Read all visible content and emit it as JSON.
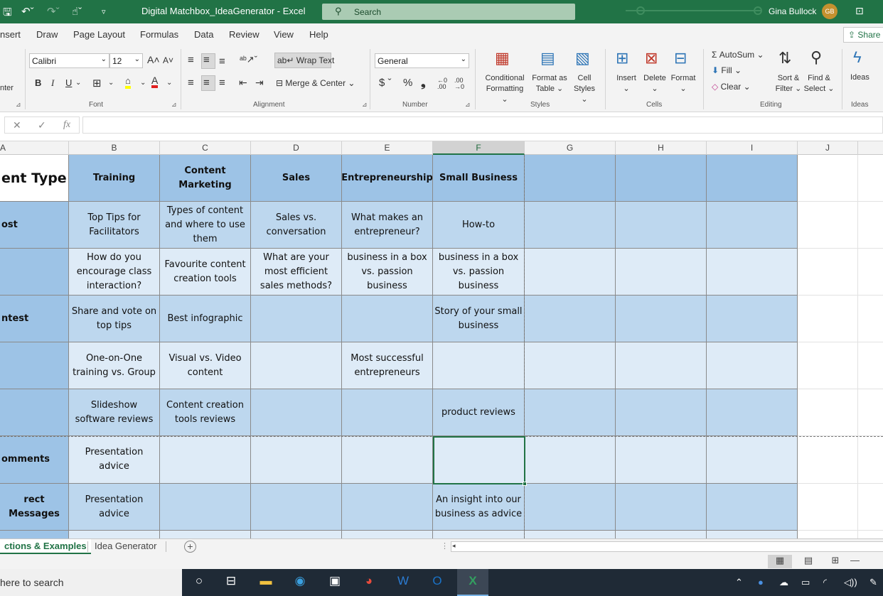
{
  "window": {
    "title": "Digital Matchbox_IdeaGenerator  -  Excel",
    "search_placeholder": "Search",
    "user_name": "Gina Bullock",
    "user_initials": "GB"
  },
  "menu": {
    "items": [
      "nsert",
      "Draw",
      "Page Layout",
      "Formulas",
      "Data",
      "Review",
      "View",
      "Help"
    ],
    "share_label": "Share"
  },
  "ribbon": {
    "font_name": "Calibri",
    "font_size": "12",
    "bold": "B",
    "italic": "I",
    "underline": "U",
    "wrap_text": "Wrap Text",
    "merge_center": "Merge & Center",
    "number_format": "General",
    "conditional_formatting": [
      "Conditional",
      "Formatting"
    ],
    "format_as_table": [
      "Format as",
      "Table"
    ],
    "cell_styles": [
      "Cell",
      "Styles"
    ],
    "insert": "Insert",
    "delete": "Delete",
    "format": "Format",
    "autosum": "AutoSum",
    "fill": "Fill",
    "clear": "Clear",
    "sort_filter": [
      "Sort &",
      "Filter"
    ],
    "find_select": [
      "Find &",
      "Select"
    ],
    "ideas": "Ideas",
    "groups": {
      "clipboard_partial": "nter",
      "font": "Font",
      "alignment": "Alignment",
      "number": "Number",
      "styles": "Styles",
      "cells": "Cells",
      "editing": "Editing",
      "ideas": "Ideas"
    }
  },
  "formula_bar": {
    "cancel": "✕",
    "enter": "✓",
    "fx": "fx",
    "value": ""
  },
  "columns": [
    "A",
    "B",
    "C",
    "D",
    "E",
    "F",
    "G",
    "H",
    "I",
    "J"
  ],
  "selected_column": "F",
  "grid": {
    "header_row": {
      "a": "ent Type",
      "cells": [
        "Training",
        "Content Marketing",
        "Sales",
        "Entrepreneurship",
        "Small Business"
      ]
    },
    "rows": [
      {
        "a": "ost",
        "cells": [
          "Top Tips for Facilitators",
          "Types of content and where to use them",
          "Sales vs. conversation",
          "What makes an entrepreneur?",
          "How-to"
        ]
      },
      {
        "a": "",
        "cells": [
          "How do you encourage class interaction?",
          "Favourite content creation tools",
          "What are your most efficient sales methods?",
          "business in a box vs. passion business",
          "business in a box vs. passion business"
        ]
      },
      {
        "a": "ntest",
        "cells": [
          "Share and vote on top tips",
          "Best infographic",
          "",
          "",
          "Story of your small business"
        ]
      },
      {
        "a": "",
        "cells": [
          "One-on-One training vs. Group",
          "Visual vs. Video content",
          "",
          "Most successful entrepreneurs",
          ""
        ]
      },
      {
        "a": "",
        "cells": [
          "Slideshow software reviews",
          "Content creation tools reviews",
          "",
          "",
          "product reviews"
        ]
      },
      {
        "a": "omments",
        "cells": [
          "Presentation advice",
          "",
          "",
          "",
          ""
        ]
      },
      {
        "a": "rect Messages",
        "cells": [
          "Presentation advice",
          "",
          "",
          "",
          "An insight into our business as advice"
        ]
      }
    ]
  },
  "sheets": {
    "active": "ctions & Examples",
    "other": "Idea Generator",
    "add": "+"
  },
  "taskbar": {
    "search_text": "here to search"
  }
}
